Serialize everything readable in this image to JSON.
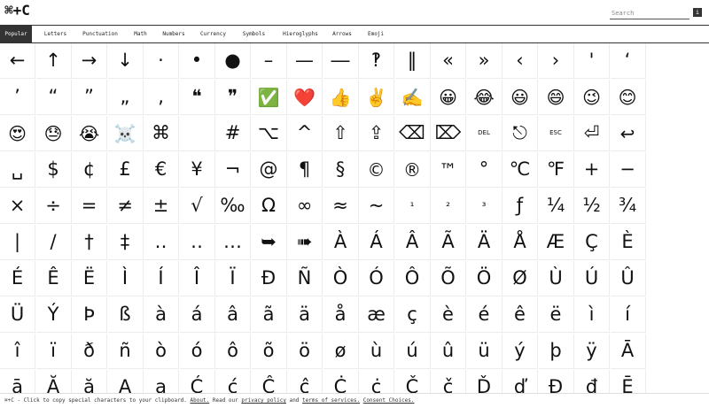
{
  "header": {
    "logo": "⌘+C",
    "search_placeholder": "Search",
    "search_button": "i"
  },
  "tabs": [
    "Popular",
    "Letters",
    "Punctuation",
    "Math",
    "Numbers",
    "Currency",
    "Symbols",
    "Hieroglyphs",
    "Arrows",
    "Emoji"
  ],
  "active_tab": "Popular",
  "grid": {
    "rows": [
      [
        "←",
        "↑",
        "→",
        "↓",
        "·",
        "•",
        "●",
        "–",
        "—",
        "―",
        "‽",
        "‖",
        "«",
        "»",
        "‹",
        "›",
        "'",
        "‘"
      ],
      [
        "’",
        "“",
        "”",
        "„",
        "‚",
        "❝",
        "❞",
        "✅",
        "❤️",
        "👍",
        "✌️",
        "✍️",
        "😀",
        "😂",
        "😃",
        "😄",
        "😉",
        "😊"
      ],
      [
        "😍",
        "😓",
        "😭",
        "☠️",
        "⌘",
        "",
        "#",
        "⌥",
        "^",
        "⇧",
        "⇪",
        "⌫",
        "⌦",
        "DEL",
        "⎋",
        "ESC",
        "⏎",
        "↩"
      ],
      [
        "␣",
        "$",
        "¢",
        "£",
        "€",
        "¥",
        "¬",
        "@",
        "¶",
        "§",
        "©",
        "®",
        "™",
        "°",
        "℃",
        "℉",
        "+",
        "−"
      ],
      [
        "×",
        "÷",
        "=",
        "≠",
        "±",
        "√",
        "‰",
        "Ω",
        "∞",
        "≈",
        "~",
        "¹",
        "²",
        "³",
        "ƒ",
        "¼",
        "½",
        "¾"
      ],
      [
        "|",
        "/",
        "†",
        "‡",
        "‥",
        "‥",
        "…",
        "➥",
        "➠",
        "À",
        "Á",
        "Â",
        "Ã",
        "Ä",
        "Å",
        "Æ",
        "Ç",
        "È"
      ],
      [
        "É",
        "Ê",
        "Ë",
        "Ì",
        "Í",
        "Î",
        "Ï",
        "Ð",
        "Ñ",
        "Ò",
        "Ó",
        "Ô",
        "Õ",
        "Ö",
        "Ø",
        "Ù",
        "Ú",
        "Û"
      ],
      [
        "Ü",
        "Ý",
        "Þ",
        "ß",
        "à",
        "á",
        "â",
        "ã",
        "ä",
        "å",
        "æ",
        "ç",
        "è",
        "é",
        "ê",
        "ë",
        "ì",
        "í"
      ],
      [
        "î",
        "ï",
        "ð",
        "ñ",
        "ò",
        "ó",
        "ô",
        "õ",
        "ö",
        "ø",
        "ù",
        "ú",
        "û",
        "ü",
        "ý",
        "þ",
        "ÿ",
        "Ā"
      ],
      [
        "ā",
        "Ă",
        "ă",
        "Ą",
        "ą",
        "Ć",
        "ć",
        "Ĉ",
        "ĉ",
        "Ċ",
        "ċ",
        "Č",
        "č",
        "Ď",
        "ď",
        "Đ",
        "đ",
        "Ē"
      ]
    ]
  },
  "footer": {
    "text_1": "⌘+C - Click to copy special characters to your clipboard.",
    "about": "About.",
    "text_2": "Read our",
    "privacy": "privacy policy",
    "text_3": "and",
    "terms": "terms of services.",
    "consent": "Consent Choices."
  }
}
